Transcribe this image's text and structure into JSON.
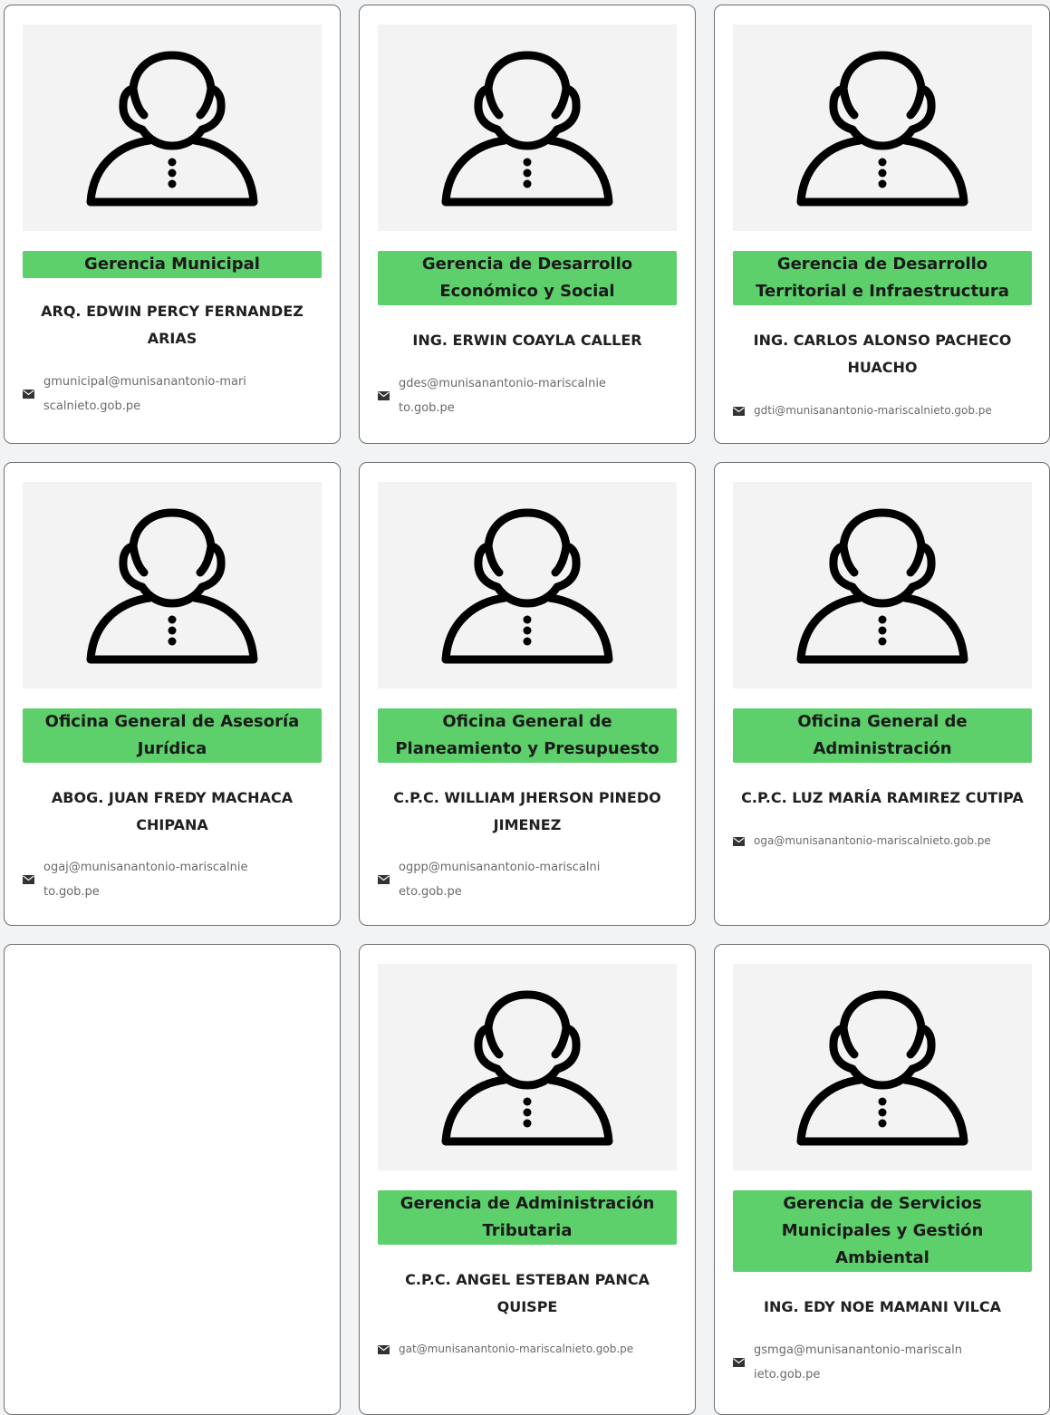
{
  "colors": {
    "badge": "#5dcf6b",
    "photo_bg": "#f3f3f3",
    "border": "#6f6f6f"
  },
  "icons": {
    "avatar": "user-avatar-icon",
    "mail": "envelope-icon"
  },
  "cards": [
    {
      "dept": "Gerencia Municipal",
      "name": "ARQ. EDWIN PERCY FERNANDEZ ARIAS",
      "email": "gmunicipal@munisanantonio-mariscalnieto.gob.pe"
    },
    {
      "dept": "Gerencia de Desarrollo Económico y Social",
      "name": "ING. ERWIN COAYLA CALLER",
      "email": "gdes@munisanantonio-mariscalnieto.gob.pe"
    },
    {
      "dept": "Gerencia de Desarrollo Territorial e Infraestructura",
      "name": "ING. CARLOS ALONSO PACHECO HUACHO",
      "email": "gdti@munisanantonio-mariscalnieto.gob.pe"
    },
    {
      "dept": "Oficina General de Asesoría Jurídica",
      "name": "ABOG. JUAN FREDY MACHACA CHIPANA",
      "email": "ogaj@munisanantonio-mariscalnieto.gob.pe"
    },
    {
      "dept": "Oficina General de Planeamiento y Presupuesto",
      "name": "C.P.C. WILLIAM JHERSON PINEDO JIMENEZ",
      "email": "ogpp@munisanantonio-mariscalnieto.gob.pe"
    },
    {
      "dept": "Oficina General de Administración",
      "name": "C.P.C. LUZ MARÍA RAMIREZ CUTIPA",
      "email": "oga@munisanantonio-mariscalnieto.gob.pe"
    },
    {
      "dept": "Gerencia de Administración Tributaria",
      "name": "C.P.C. ANGEL ESTEBAN PANCA QUISPE",
      "email": "gat@munisanantonio-mariscalnieto.gob.pe"
    },
    {
      "dept": "Gerencia de Servicios Municipales y Gestión Ambiental",
      "name": "ING. EDY NOE MAMANI VILCA",
      "email": "gsmga@munisanantonio-mariscalnieto.gob.pe"
    }
  ]
}
